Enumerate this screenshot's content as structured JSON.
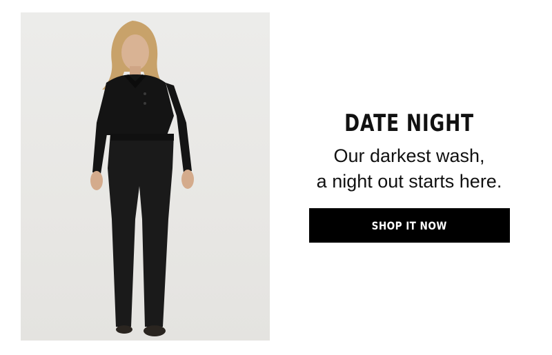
{
  "promo": {
    "headline": "DATE NIGHT",
    "subline_1": "Our darkest wash,",
    "subline_2": "a night out starts here.",
    "cta_label": "SHOP IT NOW"
  },
  "colors": {
    "button_bg": "#000000",
    "button_text": "#ffffff",
    "text": "#111111",
    "photo_bg": "#e9e8e5"
  }
}
